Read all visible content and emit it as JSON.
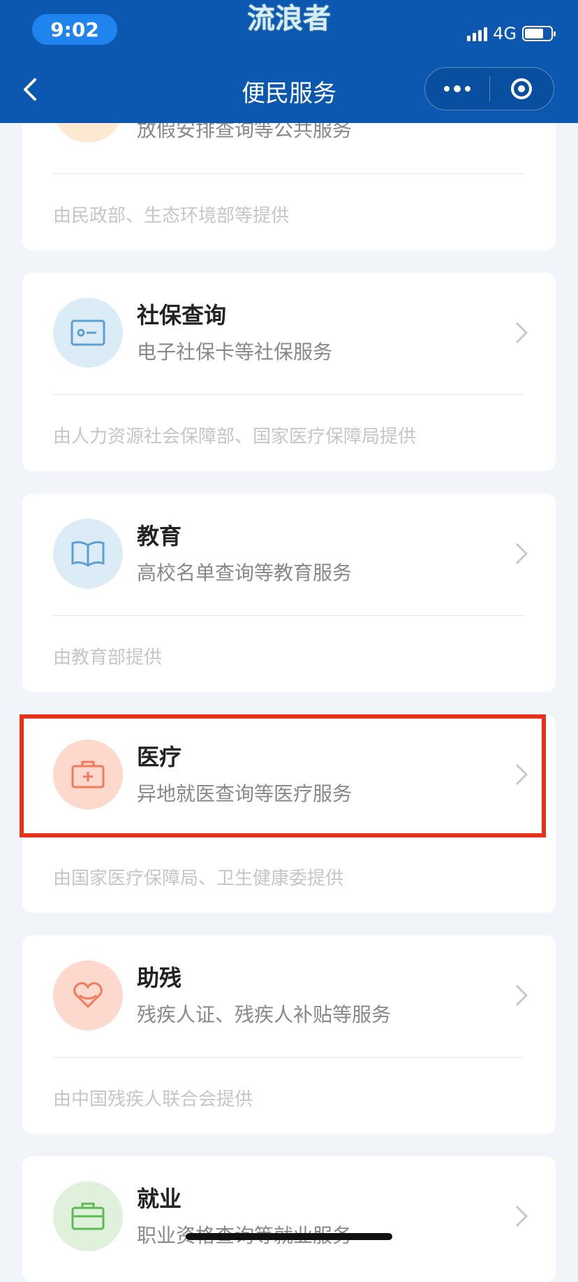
{
  "status": {
    "time": "9:02",
    "network": "4G"
  },
  "watermark": "流浪者",
  "header": {
    "title": "便民服务"
  },
  "cards": [
    {
      "name": "",
      "desc": "放假安排查询等公共服务",
      "provider": "由民政部、生态环境部等提供",
      "icon": "heart-icon",
      "color": "#f6a35a"
    },
    {
      "name": "社保查询",
      "desc": "电子社保卡等社保服务",
      "provider": "由人力资源社会保障部、国家医疗保障局提供",
      "icon": "id-card-icon",
      "color": "#5d9fd3"
    },
    {
      "name": "教育",
      "desc": "高校名单查询等教育服务",
      "provider": "由教育部提供",
      "icon": "book-icon",
      "color": "#5d9fd3"
    },
    {
      "name": "医疗",
      "desc": "异地就医查询等医疗服务",
      "provider": "由国家医疗保障局、卫生健康委提供",
      "icon": "medical-kit-icon",
      "color": "#f17a5c"
    },
    {
      "name": "助残",
      "desc": "残疾人证、残疾人补贴等服务",
      "provider": "由中国残疾人联合会提供",
      "icon": "heart-hand-icon",
      "color": "#f17a5c"
    },
    {
      "name": "就业",
      "desc": "职业资格查询等就业服务",
      "provider": "",
      "icon": "briefcase-icon",
      "color": "#5fba56"
    }
  ]
}
